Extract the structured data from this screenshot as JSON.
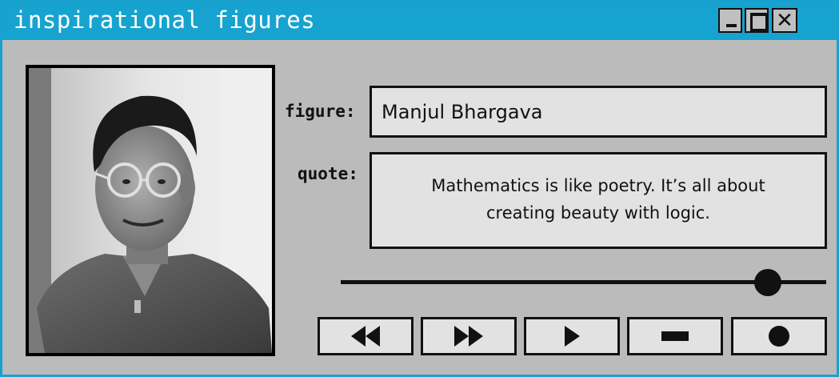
{
  "window": {
    "title": "inspirational figures",
    "controls": {
      "minimize": "minimize",
      "maximize": "maximize",
      "close": "✕"
    }
  },
  "photo": {
    "subject": "Manjul Bhargava"
  },
  "fields": {
    "figure_label": "figure:",
    "figure_value": "Manjul Bhargava",
    "quote_label": "quote:",
    "quote_value": "Mathematics is like poetry. It’s all about creating beauty with logic."
  },
  "slider": {
    "value": 0.88
  },
  "playback": {
    "buttons": [
      {
        "name": "rewind",
        "icon": "rewind-icon"
      },
      {
        "name": "fast-forward",
        "icon": "fast-forward-icon"
      },
      {
        "name": "play",
        "icon": "play-icon"
      },
      {
        "name": "stop",
        "icon": "stop-icon"
      },
      {
        "name": "record",
        "icon": "record-icon"
      }
    ]
  },
  "colors": {
    "titlebar": "#17a3d0",
    "window_bg": "#bbbbbb",
    "field_bg": "#e2e2e2"
  }
}
